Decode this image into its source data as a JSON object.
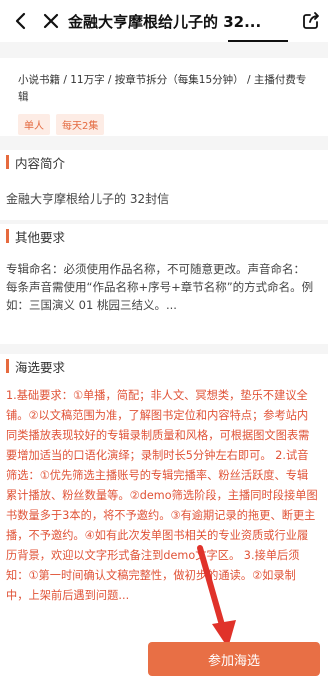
{
  "header": {
    "title": "金融大亨摩根给儿子的 32..."
  },
  "info": {
    "meta": "小说书籍 / 11万字 / 按章节拆分（每集15分钟） / 主播付费专辑",
    "tags": [
      "单人",
      "每天2集"
    ]
  },
  "intro": {
    "heading": "内容简介",
    "text": "金融大亨摩根给儿子的 32封信"
  },
  "other_requirements": {
    "heading": "其他要求",
    "text": "专辑命名：必须使用作品名称，不可随意更改。声音命名：每条声音需使用“作品名称+序号+章节名称”的方式命名。例如：三国演义 01 桃园三结义。..."
  },
  "audition": {
    "heading": "海选要求",
    "text": "1.基础要求：①单播，简配；非人文、冥想类，垫乐不建议全铺。②以文稿范围为准，了解图书定位和内容特点；参考站内同类播放表现较好的专辑录制质量和风格，可根据图文图表需要增加适当的口语化演绎；录制时长5分钟左右即可。 2.试音筛选：①优先筛选主播账号的专辑完播率、粉丝活跃度、专辑累计播放、粉丝数量等。②demo筛选阶段，主播同时段接单图书数量多于3本的，将不予邀约。③有逾期记录的拖更、断更主播，不予邀约。④如有此次发单图书相关的专业资质或行业履历背景，欢迎以文字形式备注到demo文字区。 3.接单后须知：①第一时间确认文稿完整性，做初步的通读。②如录制中，上架前后遇到问题..."
  },
  "footer": {
    "join_label": "参加海选"
  },
  "colors": {
    "accent": "#e66a3e",
    "audition_text": "#e05236",
    "arrow": "#e0322a"
  }
}
